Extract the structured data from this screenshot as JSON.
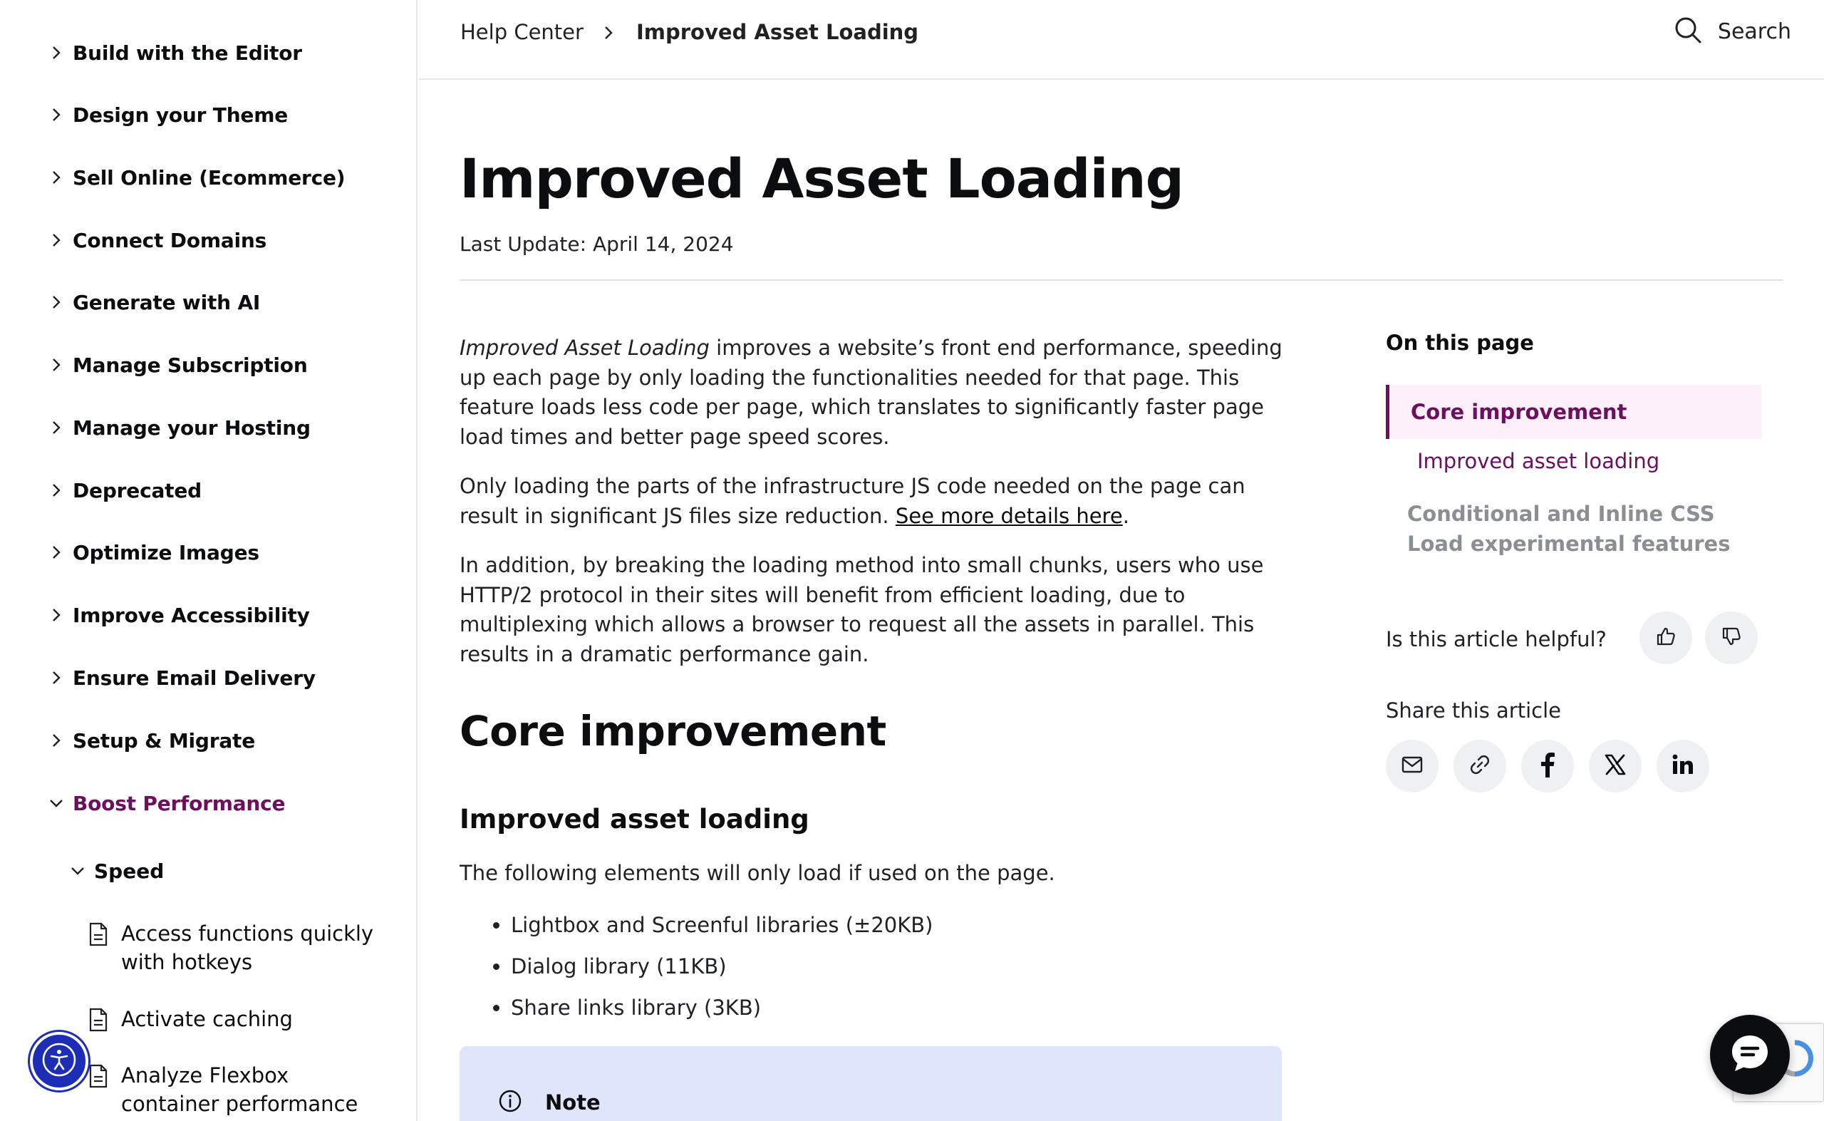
{
  "sidebar": {
    "items": [
      {
        "label": "Build with the Editor"
      },
      {
        "label": "Design your Theme"
      },
      {
        "label": "Sell Online (Ecommerce)"
      },
      {
        "label": "Connect Domains"
      },
      {
        "label": "Generate with AI"
      },
      {
        "label": "Manage Subscription"
      },
      {
        "label": "Manage your Hosting"
      },
      {
        "label": "Deprecated"
      },
      {
        "label": "Optimize Images"
      },
      {
        "label": "Improve Accessibility"
      },
      {
        "label": "Ensure Email Delivery"
      },
      {
        "label": "Setup & Migrate"
      },
      {
        "label": "Boost Performance"
      }
    ],
    "sub_section": {
      "label": "Speed"
    },
    "articles": [
      {
        "label": "Access functions quickly with hotkeys"
      },
      {
        "label": "Activate caching"
      },
      {
        "label": "Analyze Flexbox container performance"
      }
    ],
    "active_color": "#6b0f5e"
  },
  "header": {
    "breadcrumb": {
      "home": "Help Center",
      "current": "Improved Asset Loading"
    },
    "search_label": "Search"
  },
  "main": {
    "title": "Improved Asset Loading",
    "last_update": "Last Update: April 14, 2024",
    "intro_em": "Improved Asset Loading",
    "intro_rest": " improves a website’s front end performance, speeding up each page by only loading the functionalities needed for that page. This feature loads less code per page, which translates to significantly faster page load times and better page speed scores.",
    "para2_text": "Only loading the parts of the infrastructure JS code needed on the page can result in significant JS files size reduction. ",
    "para2_link": "See more details here",
    "para2_end": ".",
    "para3": "In addition, by breaking the loading method into small chunks, users who use HTTP/2 protocol in their sites will benefit from efficient loading, due to multiplexing which allows a browser to request all the assets in parallel. This results in a dramatic performance gain.",
    "h2": "Core improvement",
    "h3": "Improved asset loading",
    "following": "The following elements will only load if used on the page.",
    "libraries": [
      "Lightbox and Screenful libraries (±20KB)",
      "Dialog library (11KB)",
      "Share links library (3KB)"
    ],
    "note_label": "Note"
  },
  "rail": {
    "on_this_page": "On this page",
    "toc": [
      {
        "label": "Core improvement"
      },
      {
        "label": "Improved asset loading"
      },
      {
        "label": "Conditional and Inline CSS Load experimental features"
      }
    ],
    "helpful": "Is this article helpful?",
    "share": "Share this article",
    "share_icons": [
      "email-icon",
      "link-icon",
      "facebook-icon",
      "x-icon",
      "linkedin-icon"
    ]
  },
  "colors": {
    "accent": "#6b0f5e",
    "toc_active_bg": "#fdf0fb",
    "note_bg": "#dfe6fb",
    "a11y_blue": "#1d2db6"
  }
}
